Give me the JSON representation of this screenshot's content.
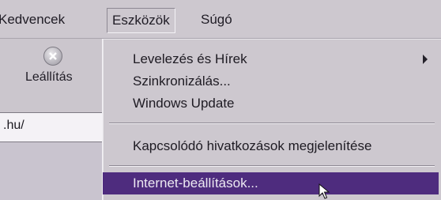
{
  "menubar": {
    "items": [
      {
        "label": "Kedvencek"
      },
      {
        "label": "Eszközök"
      },
      {
        "label": "Súgó"
      }
    ]
  },
  "toolbar": {
    "stop_label": "Leállítás",
    "stop_icon": "stop-icon"
  },
  "address": {
    "value": ".hu/"
  },
  "dropdown": {
    "items": [
      {
        "label": "Levelezés és Hírek",
        "submenu": true
      },
      {
        "label": "Szinkronizálás..."
      },
      {
        "label": "Windows Update"
      },
      {
        "label": "Kapcsolódó hivatkozások megjelenítése"
      },
      {
        "label": "Internet-beállítások..."
      }
    ],
    "selected_index": 4,
    "selected_color": "#4e2c7e"
  }
}
